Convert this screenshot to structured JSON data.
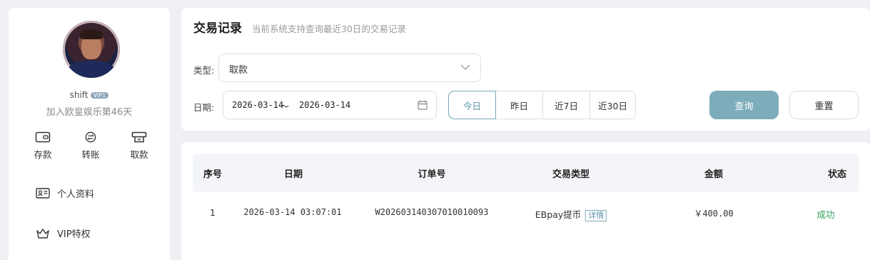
{
  "sidebar": {
    "username": "shift",
    "vip_badge": "VIP1",
    "joined_text": "加入欧皇娱乐第46天",
    "quick_actions": [
      {
        "label": "存款",
        "icon": "wallet-icon"
      },
      {
        "label": "转账",
        "icon": "transfer-icon"
      },
      {
        "label": "取款",
        "icon": "withdraw-icon"
      }
    ],
    "menu": [
      {
        "label": "个人资料",
        "icon": "id-card-icon"
      },
      {
        "label": "VIP特权",
        "icon": "crown-icon"
      }
    ]
  },
  "filter": {
    "title": "交易记录",
    "subtitle": "当前系统支持查询最近30日的交易记录",
    "type_label": "类型:",
    "type_value": "取款",
    "date_label": "日期:",
    "date_start": "2026-03-14",
    "date_sep": "～",
    "date_end": "2026-03-14",
    "ranges": [
      "今日",
      "昨日",
      "近7日",
      "近30日"
    ],
    "active_range": "今日",
    "search_label": "查询",
    "reset_label": "重置"
  },
  "table": {
    "headers": [
      "序号",
      "日期",
      "订单号",
      "交易类型",
      "金额",
      "状态"
    ],
    "rows": [
      {
        "index": "1",
        "date": "2026-03-14 03:07:01",
        "order_no": "W20260314030701001009З",
        "type": "EBpay提币",
        "detail_label": "详情",
        "amount": "￥400.00",
        "status": "成功"
      }
    ]
  },
  "colors": {
    "accent": "#7dacba",
    "success": "#2aa05a",
    "background": "#eef0f4"
  }
}
